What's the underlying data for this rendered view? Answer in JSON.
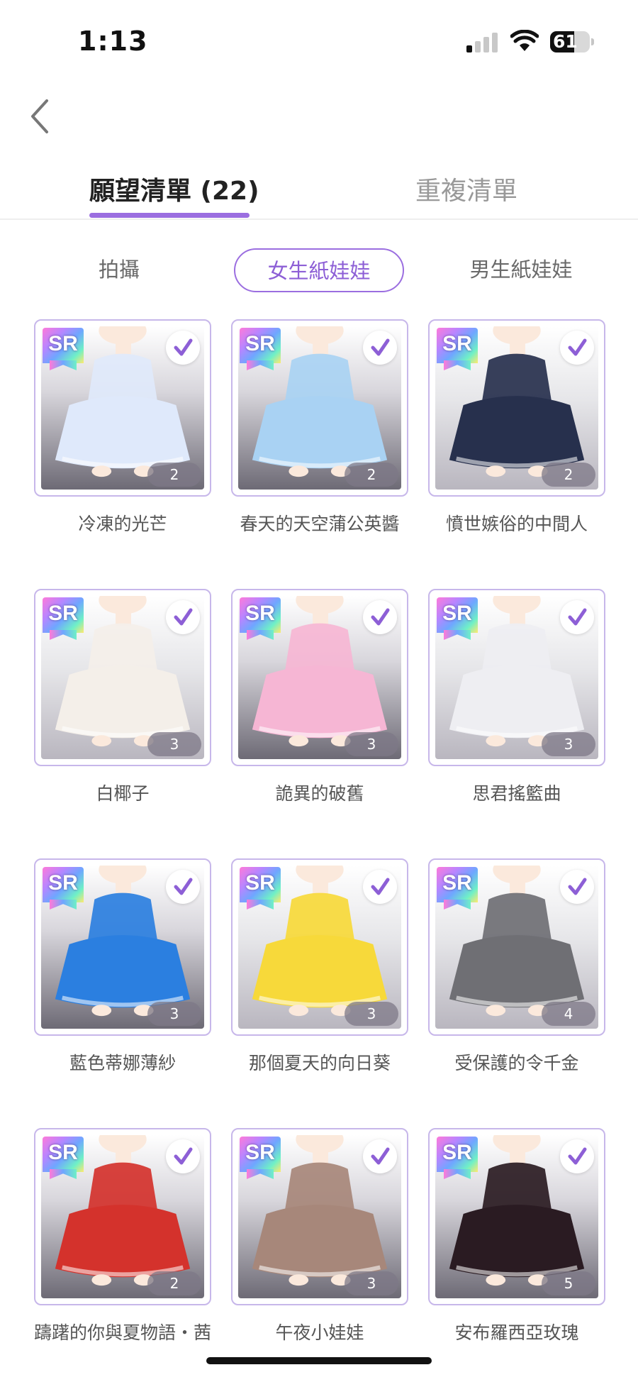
{
  "status_bar": {
    "time": "1:13",
    "battery": "61",
    "battery_level": 0.61
  },
  "tabs": [
    {
      "label": "願望清單 (22)",
      "active": true
    },
    {
      "label": "重複清單",
      "active": false
    }
  ],
  "sub_tabs": [
    {
      "label": "拍攝",
      "active": false
    },
    {
      "label": "女生紙娃娃",
      "active": true
    },
    {
      "label": "男生紙娃娃",
      "active": false
    }
  ],
  "badge_text": "SR",
  "colors": {
    "accent": "#9b6ee0",
    "card_border": "#c7b7ea"
  },
  "items": [
    {
      "name": "冷凍的光芒",
      "count": "2",
      "outfit": "white-blue-frost-gown",
      "dress_color": "#dfe9fb"
    },
    {
      "name": "春天的天空蒲公英醬",
      "count": "2",
      "outfit": "light-blue-plaid-dress",
      "dress_color": "#a9d2f3"
    },
    {
      "name": "憤世嫉俗的中間人",
      "count": "2",
      "outfit": "navy-jacket-outfit",
      "dress_color": "#27304d"
    },
    {
      "name": "白椰子",
      "count": "3",
      "outfit": "white-crop-top-shorts",
      "dress_color": "#f4efe9"
    },
    {
      "name": "詭異的破舊",
      "count": "3",
      "outfit": "pink-ruffle-dress",
      "dress_color": "#f6b6d4"
    },
    {
      "name": "思君搖籃曲",
      "count": "3",
      "outfit": "white-lace-dress",
      "dress_color": "#eeeef2"
    },
    {
      "name": "藍色蒂娜薄紗",
      "count": "3",
      "outfit": "blue-ruffle-gown",
      "dress_color": "#2b7fe0"
    },
    {
      "name": "那個夏天的向日葵",
      "count": "3",
      "outfit": "yellow-striped-dress",
      "dress_color": "#f7d93a"
    },
    {
      "name": "受保護的令千金",
      "count": "4",
      "outfit": "grey-gothic-dress",
      "dress_color": "#6f6f74"
    },
    {
      "name": "躊躇的你與夏物語・茜",
      "count": "2",
      "outfit": "red-kimono-dress",
      "dress_color": "#d4322c"
    },
    {
      "name": "午夜小娃娃",
      "count": "3",
      "outfit": "brown-lolita-dress",
      "dress_color": "#a7877a"
    },
    {
      "name": "安布羅西亞玫瑰",
      "count": "5",
      "outfit": "black-red-rose-gown",
      "dress_color": "#2a1b22"
    }
  ]
}
